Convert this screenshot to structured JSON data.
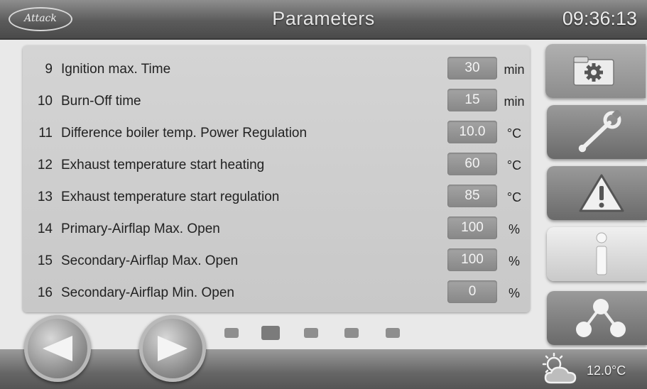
{
  "header": {
    "logo": "Attack",
    "title": "Parameters",
    "time": "09:36:13"
  },
  "parameters": [
    {
      "num": "9",
      "label": "Ignition max. Time",
      "value": "30",
      "unit": "min"
    },
    {
      "num": "10",
      "label": "Burn-Off time",
      "value": "15",
      "unit": "min"
    },
    {
      "num": "11",
      "label": "Difference boiler temp. Power Regulation",
      "value": "10.0",
      "unit": "°C"
    },
    {
      "num": "12",
      "label": "Exhaust temperature start heating",
      "value": "60",
      "unit": "°C"
    },
    {
      "num": "13",
      "label": "Exhaust temperature start regulation",
      "value": "85",
      "unit": "°C"
    },
    {
      "num": "14",
      "label": "Primary-Airflap Max. Open",
      "value": "100",
      "unit": "%"
    },
    {
      "num": "15",
      "label": "Secondary-Airflap Max. Open",
      "value": "100",
      "unit": "%"
    },
    {
      "num": "16",
      "label": "Secondary-Airflap Min. Open",
      "value": "0",
      "unit": "%"
    }
  ],
  "sidebar": {
    "items": [
      {
        "icon": "gear-folder-icon",
        "active": true
      },
      {
        "icon": "wrench-icon"
      },
      {
        "icon": "warning-icon"
      },
      {
        "icon": "info-icon"
      },
      {
        "icon": "network-icon"
      }
    ]
  },
  "pagination": {
    "pages": 5,
    "current": 2
  },
  "footer": {
    "weather_icon": "partly-cloudy-icon",
    "temperature": "12.0°C"
  }
}
